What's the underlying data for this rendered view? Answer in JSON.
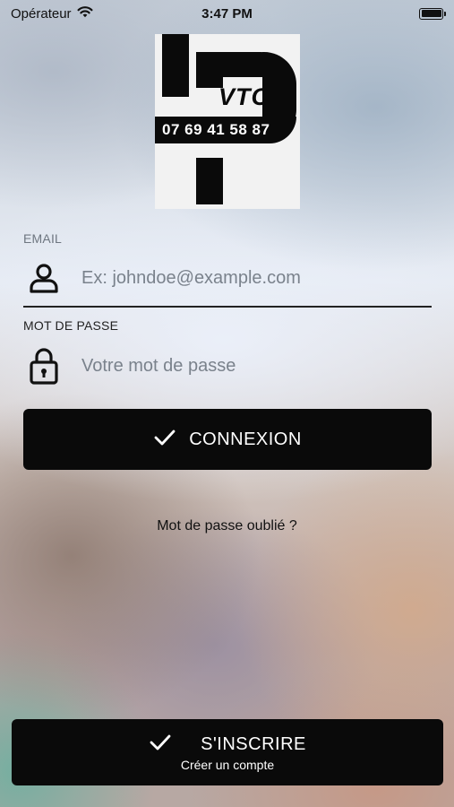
{
  "status_bar": {
    "carrier": "Opérateur",
    "time": "3:47 PM"
  },
  "logo": {
    "text": "VTC",
    "phone": "07 69 41 58 87"
  },
  "email": {
    "label": "EMAIL",
    "placeholder": "Ex: johndoe@example.com",
    "value": ""
  },
  "password": {
    "label": "MOT DE PASSE",
    "placeholder": "Votre mot de passe",
    "value": ""
  },
  "login_button": {
    "label": "CONNEXION"
  },
  "forgot_link": {
    "label": "Mot de passe oublié ?"
  },
  "signup_button": {
    "label": "S'INSCRIRE",
    "sublabel": "Créer un compte"
  },
  "icons": {
    "wifi": "wifi-icon",
    "battery": "battery-icon",
    "user": "user-icon",
    "lock": "lock-icon",
    "check": "checkmark-icon"
  },
  "colors": {
    "button_bg": "#0a0a0a",
    "button_text": "#ffffff",
    "label_active": "#222222",
    "label_muted": "#6e7680"
  }
}
